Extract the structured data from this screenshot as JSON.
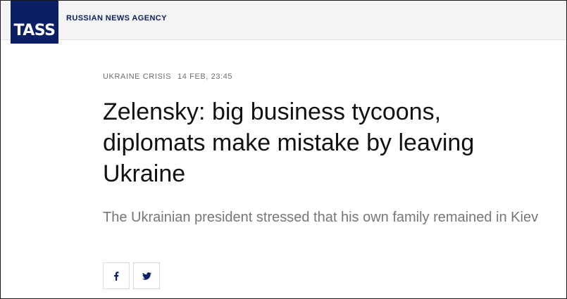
{
  "header": {
    "logo_text": "TASS",
    "agency_label": "RUSSIAN NEWS AGENCY"
  },
  "article": {
    "category": "UKRAINE CRISIS",
    "timestamp": "14 FEB, 23:45",
    "headline": "Zelensky: big business tycoons, diplomats make mistake by leaving Ukraine",
    "lead": "The Ukrainian president stressed that his own family remained in Kiev"
  },
  "share": {
    "buttons": [
      {
        "icon": "facebook-icon"
      },
      {
        "icon": "twitter-icon"
      }
    ]
  },
  "colors": {
    "brand_navy": "#0a1f64",
    "header_bg": "#f4f4f4",
    "headline": "#111111",
    "lead": "#777777",
    "meta": "#6e6e6e"
  }
}
